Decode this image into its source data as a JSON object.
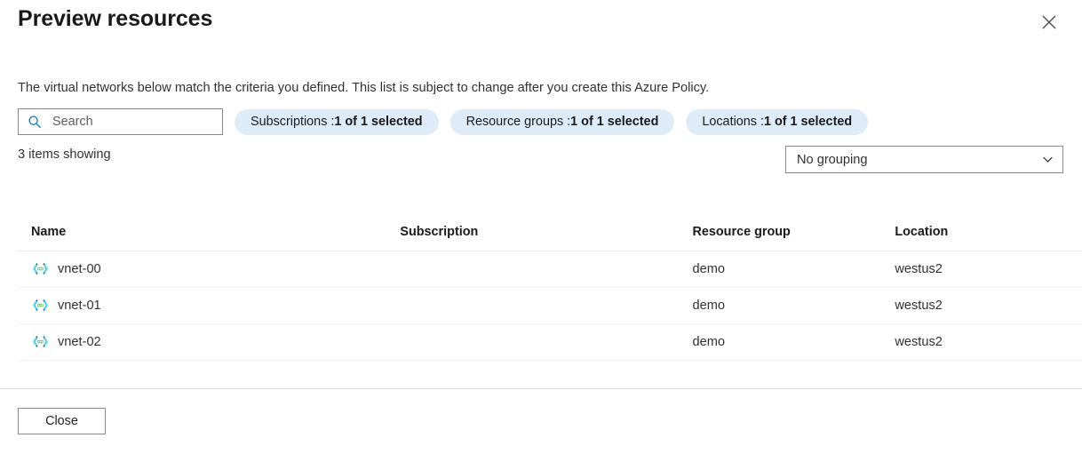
{
  "header": {
    "title": "Preview resources",
    "close_icon": "close-icon"
  },
  "description": "The virtual networks below match the criteria you defined. This list is subject to change after you create this Azure Policy.",
  "filters": {
    "search": {
      "placeholder": "Search",
      "value": "",
      "icon": "search-icon"
    },
    "pills": [
      {
        "key": "Subscriptions : ",
        "value": "1 of 1 selected"
      },
      {
        "key": "Resource groups : ",
        "value": "1 of 1 selected"
      },
      {
        "key": "Locations : ",
        "value": "1 of 1 selected"
      }
    ]
  },
  "summary": {
    "items_count": "3 items showing"
  },
  "grouping": {
    "selected": "No grouping",
    "chevron_icon": "chevron-down-icon"
  },
  "table": {
    "columns": [
      {
        "label": "Name"
      },
      {
        "label": "Subscription"
      },
      {
        "label": "Resource group"
      },
      {
        "label": "Location"
      }
    ],
    "rows": [
      {
        "icon": "virtual-network-icon",
        "name": "vnet-00",
        "subscription": "",
        "resource_group": "demo",
        "location": "westus2"
      },
      {
        "icon": "virtual-network-icon",
        "name": "vnet-01",
        "subscription": "",
        "resource_group": "demo",
        "location": "westus2"
      },
      {
        "icon": "virtual-network-icon",
        "name": "vnet-02",
        "subscription": "",
        "resource_group": "demo",
        "location": "westus2"
      }
    ]
  },
  "footer": {
    "close_label": "Close"
  },
  "colors": {
    "pill_background": "#deecf9",
    "search_icon": "#0078d4",
    "text_primary": "#323130",
    "text_heading": "#1b1a19",
    "border": "#8a8886",
    "row_divider": "#f3f2f1",
    "vnet_blue": "#0078d4",
    "vnet_cyan": "#50e6ff",
    "vnet_green": "#5bb75b"
  }
}
